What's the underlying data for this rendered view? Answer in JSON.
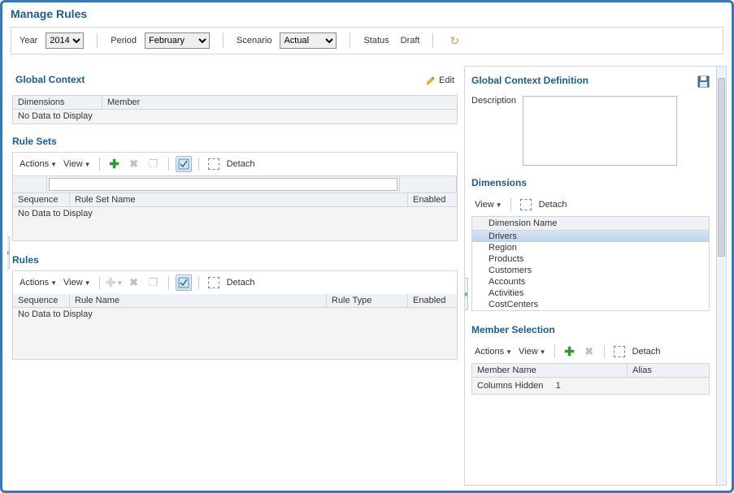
{
  "title": "Manage Rules",
  "filters": {
    "year": {
      "label": "Year",
      "value": "2014",
      "options": [
        "2014"
      ]
    },
    "period": {
      "label": "Period",
      "value": "February",
      "options": [
        "February"
      ]
    },
    "scenario": {
      "label": "Scenario",
      "value": "Actual",
      "options": [
        "Actual"
      ]
    },
    "status": {
      "label": "Status",
      "value": "Draft"
    }
  },
  "globalContext": {
    "title": "Global Context",
    "editLabel": "Edit",
    "columns": {
      "dimensions": "Dimensions",
      "member": "Member"
    },
    "nodata": "No Data to Display"
  },
  "ruleSets": {
    "title": "Rule Sets",
    "toolbar": {
      "actions": "Actions",
      "view": "View",
      "detach": "Detach"
    },
    "columns": {
      "sequence": "Sequence",
      "ruleSetName": "Rule Set Name",
      "enabled": "Enabled"
    },
    "nodata": "No Data to Display"
  },
  "rules": {
    "title": "Rules",
    "toolbar": {
      "actions": "Actions",
      "view": "View",
      "detach": "Detach"
    },
    "columns": {
      "sequence": "Sequence",
      "ruleName": "Rule Name",
      "ruleType": "Rule Type",
      "enabled": "Enabled"
    },
    "nodata": "No Data to Display"
  },
  "definition": {
    "title": "Global Context Definition",
    "descLabel": "Description",
    "descValue": ""
  },
  "dimensions": {
    "title": "Dimensions",
    "toolbar": {
      "view": "View",
      "detach": "Detach"
    },
    "header": "Dimension Name",
    "items": [
      "Drivers",
      "Region",
      "Products",
      "Customers",
      "Accounts",
      "Activities",
      "CostCenters"
    ],
    "selectedIndex": 0
  },
  "memberSelection": {
    "title": "Member Selection",
    "toolbar": {
      "actions": "Actions",
      "view": "View",
      "detach": "Detach"
    },
    "columns": {
      "memberName": "Member Name",
      "alias": "Alias"
    },
    "colsHiddenLabel": "Columns Hidden",
    "colsHiddenCount": "1"
  }
}
